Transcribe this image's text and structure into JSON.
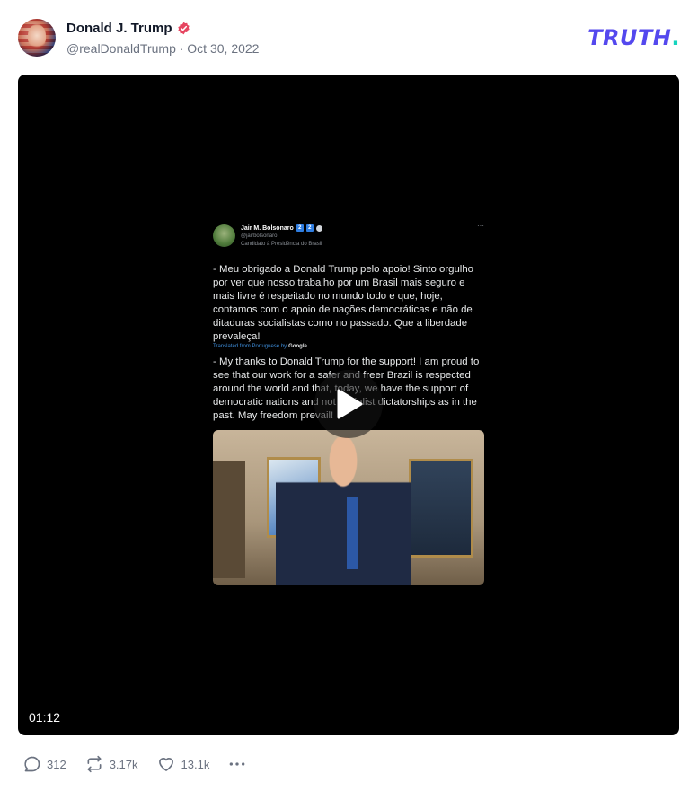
{
  "post": {
    "author_name": "Donald J. Trump",
    "author_meta": "@realDonaldTrump · Oct 30, 2022",
    "logo_text": "TRUTH",
    "logo_dot": ".",
    "video_duration": "01:12"
  },
  "embedded_tweet": {
    "name": "Jair M. Bolsonaro",
    "badge_1": "2",
    "badge_2": "2",
    "handle": "@jairbolsonaro",
    "candidate_label": "Candidato à Presidência do Brasil",
    "more": "···",
    "text_pt": "- Meu obrigado a Donald Trump pelo apoio! Sinto orgulho por ver que nosso trabalho por um Brasil mais seguro e mais livre é respeitado no mundo todo e que, hoje, contamos com o apoio de nações democráticas e não de ditaduras socialistas como no passado. Que a liberdade prevaleça!",
    "translated_label": "Translated from Portuguese by",
    "translated_brand": "Google",
    "text_en": "- My thanks to Donald Trump for the support! I am proud to see that our work for a safer and freer Brazil is respected around the world and that, today, we have the support of democratic nations and not socialist dictatorships as in the past. May freedom prevail!"
  },
  "actions": {
    "replies": "312",
    "retruths": "3.17k",
    "likes": "13.1k",
    "more_icon": "more-dots-icon"
  },
  "colors": {
    "brand": "#5448ee",
    "brand_accent": "#15d4be",
    "verified": "#e64560",
    "meta_text": "#6b7280",
    "video_bg": "#000000"
  }
}
